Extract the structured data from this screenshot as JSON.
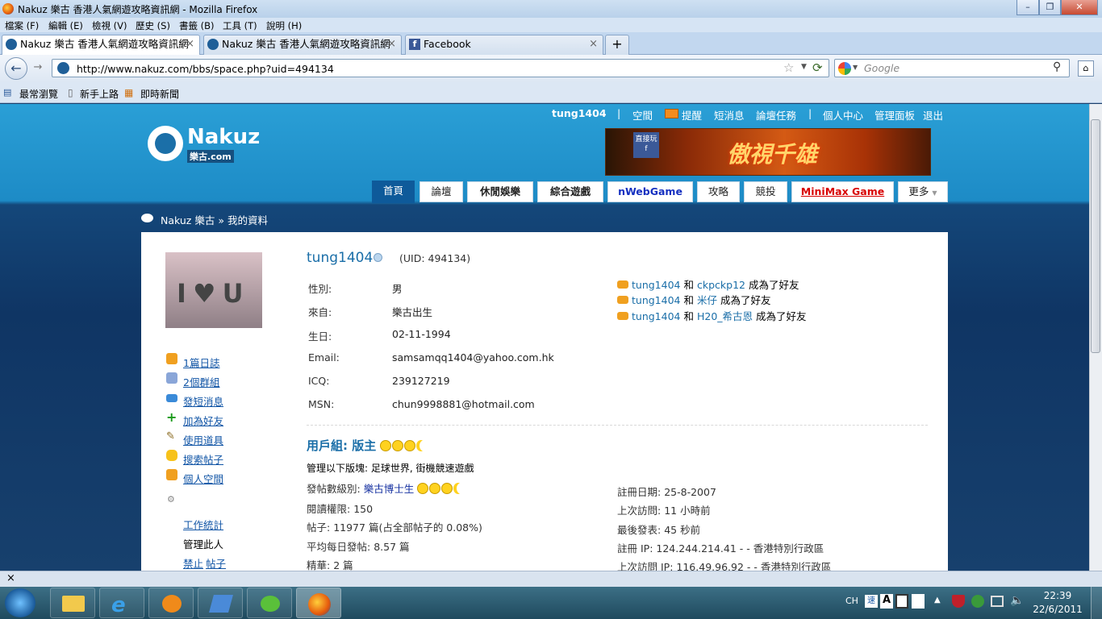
{
  "window": {
    "title": "Nakuz 樂古 香港人氣網遊攻略資訊網 - Mozilla Firefox"
  },
  "menu": [
    "檔案 (F)",
    "編輯 (E)",
    "檢視 (V)",
    "歷史 (S)",
    "書籤 (B)",
    "工具 (T)",
    "說明 (H)"
  ],
  "tabs": [
    {
      "label": "Nakuz 樂古 香港人氣網遊攻略資訊網",
      "active": true
    },
    {
      "label": "Nakuz 樂古 香港人氣網遊攻略資訊網",
      "active": false
    },
    {
      "label": "Facebook",
      "active": false
    }
  ],
  "tab_new": "+",
  "url": "http://www.nakuz.com/bbs/space.php?uid=494134",
  "search_placeholder": "Google",
  "bookmarks": [
    "最常瀏覽",
    "新手上路",
    "即時新聞"
  ],
  "site": {
    "toplinks": {
      "user": "tung1404",
      "sep": "|",
      "space": "空間",
      "remind": "提醒",
      "sms": "短消息",
      "tasks": "論壇任務",
      "center": "個人中心",
      "admin": "管理面板",
      "logout": "退出"
    },
    "logo": "Nakuz",
    "logo_sub": "樂古.com",
    "banner_text": "傲視千雄",
    "banner_fb": "直接玩",
    "nav": [
      "首頁",
      "論壇",
      "休閒娛樂",
      "綜合遊戲",
      "nWebGame",
      "攻略",
      "競投",
      "MiniMax Game",
      "更多"
    ],
    "breadcrumb": {
      "home": "Nakuz 樂古",
      "sep": "»",
      "current": "我的資料"
    }
  },
  "profile": {
    "avatar_text": "I♥U",
    "username": "tung1404",
    "uid": "(UID: 494134)",
    "fields": [
      {
        "label": "性別:",
        "value": "男"
      },
      {
        "label": "來自:",
        "value": "樂古出生"
      },
      {
        "label": "生日:",
        "value": "02-11-1994"
      },
      {
        "label": "Email:",
        "value": "samsamqq1404@yahoo.com.hk"
      },
      {
        "label": "ICQ:",
        "value": "239127219"
      },
      {
        "label": "MSN:",
        "value": "chun9998881@hotmail.com"
      }
    ],
    "feed": [
      {
        "user": "tung1404",
        "and": "和",
        "friend": "ckpckp12",
        "text": "成為了好友"
      },
      {
        "user": "tung1404",
        "and": "和",
        "friend": "米仔",
        "text": "成為了好友"
      },
      {
        "user": "tung1404",
        "and": "和",
        "friend": "H20_希古恩",
        "text": "成為了好友"
      }
    ],
    "sidebar": [
      "1篇日誌",
      "2個群組",
      "發短消息",
      "加為好友",
      "使用道具",
      "搜索帖子",
      "個人空間"
    ],
    "sidebar_extra": [
      "工作統計",
      "管理此人",
      "禁止",
      "帖子"
    ],
    "usergroup_label": "用戶組: 版主",
    "manage_label": "管理以下版塊:",
    "manage_value": "足球世界, 街機競速遊戲",
    "stats_left": [
      {
        "label": "發帖數級別:",
        "value": "樂古博士生"
      },
      {
        "label": "閱讀權限:",
        "value": "150"
      },
      {
        "label": "帖子:",
        "value": "11977 篇(占全部帖子的 0.08%)"
      },
      {
        "label": "平均每日發帖:",
        "value": "8.57 篇"
      },
      {
        "label": "精華:",
        "value": "2 篇"
      }
    ],
    "stats_right": [
      {
        "label": "註冊日期:",
        "value": "25-8-2007"
      },
      {
        "label": "上次訪問:",
        "value": "11 小時前"
      },
      {
        "label": "最後發表:",
        "value": "45 秒前"
      },
      {
        "label": "註冊 IP:",
        "value": "124.244.214.41 - - 香港特別行政區"
      },
      {
        "label": "上次訪問 IP:",
        "value": "116.49.96.92 - - 香港特別行政區"
      }
    ]
  },
  "statusbar_close": "×",
  "taskbar": {
    "lang": "CH",
    "time": "22:39",
    "date": "22/6/2011"
  }
}
